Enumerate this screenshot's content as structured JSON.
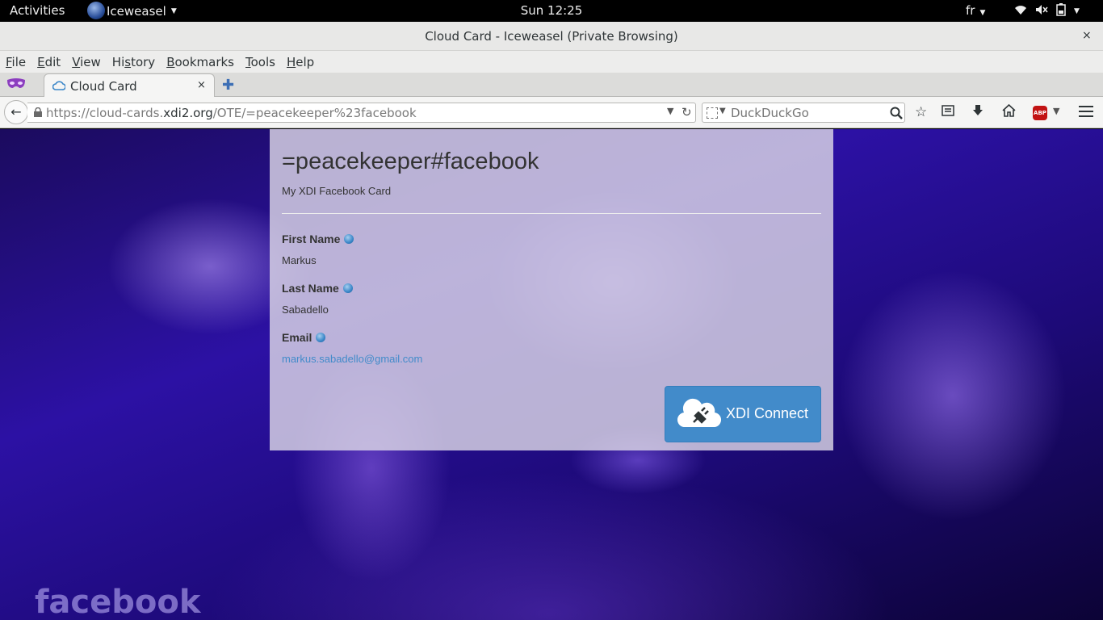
{
  "system_bar": {
    "activities": "Activities",
    "app_name": "Iceweasel",
    "clock": "Sun 12:25",
    "language": "fr"
  },
  "window": {
    "title": "Cloud Card - Iceweasel (Private Browsing)",
    "close_glyph": "×"
  },
  "menu": {
    "items": [
      {
        "accel": "F",
        "rest": "ile"
      },
      {
        "accel": "E",
        "rest": "dit"
      },
      {
        "accel": "V",
        "rest": "iew"
      },
      {
        "accel": "",
        "pre": "Hi",
        "accel2": "s",
        "rest": "tory"
      },
      {
        "accel": "B",
        "rest": "ookmarks"
      },
      {
        "accel": "T",
        "rest": "ools"
      },
      {
        "accel": "H",
        "rest": "elp"
      }
    ]
  },
  "tabs": {
    "active": {
      "label": "Cloud Card",
      "close_glyph": "×"
    },
    "new_tab_glyph": "✚"
  },
  "navbar": {
    "url_prefix": "https://cloud-cards.",
    "url_domain": "xdi2.org",
    "url_suffix": "/OTE/=peacekeeper%23facebook",
    "search_placeholder": "DuckDuckGo"
  },
  "card": {
    "title": "=peacekeeper#facebook",
    "subtitle": "My XDI Facebook Card",
    "fields": [
      {
        "label": "First Name",
        "value": "Markus"
      },
      {
        "label": "Last Name",
        "value": "Sabadello"
      },
      {
        "label": "Email",
        "value": "markus.sabadello@gmail.com"
      }
    ],
    "connect_label": "XDI Connect"
  },
  "background": {
    "logo_text": "facebook"
  },
  "colors": {
    "accent": "#428bca",
    "abp_red": "#c21313"
  }
}
